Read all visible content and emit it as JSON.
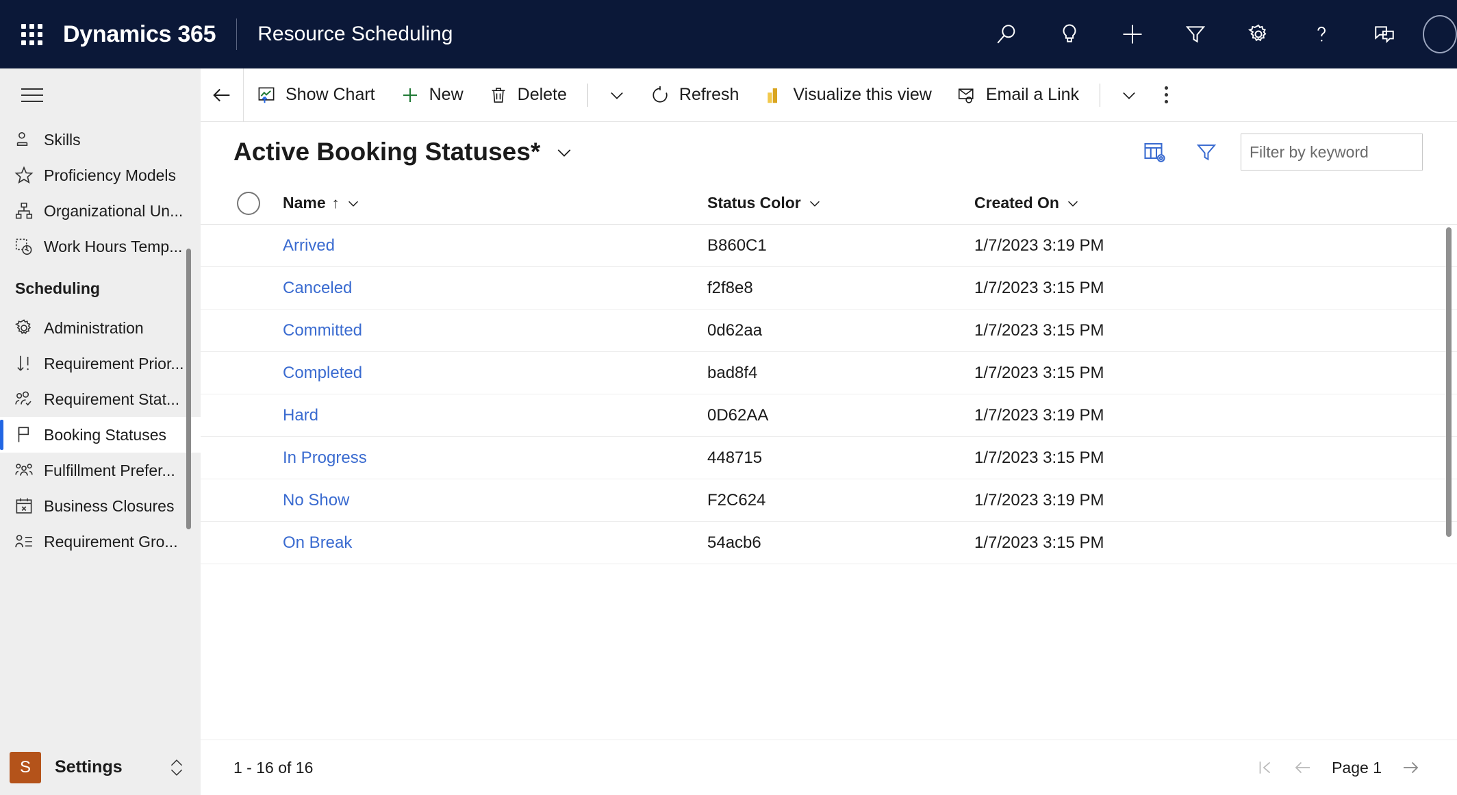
{
  "topbar": {
    "waffle_label": "app-launcher",
    "brand": "Dynamics 365",
    "app_name": "Resource Scheduling",
    "icons": [
      "search-icon",
      "lightbulb-icon",
      "plus-icon",
      "filter-icon",
      "gear-icon",
      "help-icon",
      "feedback-icon",
      "avatar"
    ]
  },
  "sidebar": {
    "items": [
      {
        "label": "Skills",
        "icon": "person-card-icon",
        "selected": false
      },
      {
        "label": "Proficiency Models",
        "icon": "star-icon",
        "selected": false
      },
      {
        "label": "Organizational Un...",
        "icon": "org-chart-icon",
        "selected": false
      },
      {
        "label": "Work Hours Temp...",
        "icon": "clock-template-icon",
        "selected": false
      }
    ],
    "group_title": "Scheduling",
    "group_items": [
      {
        "label": "Administration",
        "icon": "gear-icon",
        "selected": false
      },
      {
        "label": "Requirement Prior...",
        "icon": "sort-priority-icon",
        "selected": false
      },
      {
        "label": "Requirement Stat...",
        "icon": "people-check-icon",
        "selected": false
      },
      {
        "label": "Booking Statuses",
        "icon": "flag-icon",
        "selected": true
      },
      {
        "label": "Fulfillment Prefer...",
        "icon": "people-group-icon",
        "selected": false
      },
      {
        "label": "Business Closures",
        "icon": "calendar-x-icon",
        "selected": false
      },
      {
        "label": "Requirement Gro...",
        "icon": "person-list-icon",
        "selected": false
      }
    ],
    "settings": {
      "tile_letter": "S",
      "label": "Settings",
      "accent": "#b4531a"
    }
  },
  "commandbar": {
    "back": "back-arrow",
    "buttons": [
      {
        "label": "Show Chart",
        "icon": "chart-icon"
      },
      {
        "label": "New",
        "icon": "plus-icon"
      },
      {
        "label": "Delete",
        "icon": "trash-icon"
      }
    ],
    "buttons2": [
      {
        "label": "Refresh",
        "icon": "refresh-icon"
      },
      {
        "label": "Visualize this view",
        "icon": "bar-chart-icon"
      },
      {
        "label": "Email a Link",
        "icon": "email-link-icon"
      }
    ],
    "overflow": "more-commands"
  },
  "view": {
    "title": "Active Booking Statuses*",
    "edit_columns_icon": "edit-columns-icon",
    "filter_icon": "filter-icon",
    "search": {
      "placeholder": "Filter by keyword",
      "value": ""
    }
  },
  "table": {
    "columns": [
      {
        "label": "Name",
        "sort": "↑"
      },
      {
        "label": "Status Color",
        "sort": ""
      },
      {
        "label": "Created On",
        "sort": ""
      }
    ],
    "rows": [
      {
        "name": "Arrived",
        "status_color": "B860C1",
        "created_on": "1/7/2023 3:19 PM"
      },
      {
        "name": "Canceled",
        "status_color": "f2f8e8",
        "created_on": "1/7/2023 3:15 PM"
      },
      {
        "name": "Committed",
        "status_color": "0d62aa",
        "created_on": "1/7/2023 3:15 PM"
      },
      {
        "name": "Completed",
        "status_color": "bad8f4",
        "created_on": "1/7/2023 3:15 PM"
      },
      {
        "name": "Hard",
        "status_color": "0D62AA",
        "created_on": "1/7/2023 3:19 PM"
      },
      {
        "name": "In Progress",
        "status_color": "448715",
        "created_on": "1/7/2023 3:15 PM"
      },
      {
        "name": "No Show",
        "status_color": "F2C624",
        "created_on": "1/7/2023 3:19 PM"
      },
      {
        "name": "On Break",
        "status_color": "54acb6",
        "created_on": "1/7/2023 3:15 PM"
      }
    ]
  },
  "footer": {
    "count": "1 - 16 of 16",
    "page_label": "Page 1",
    "first_icon": "first-page-icon",
    "prev_icon": "previous-page-icon",
    "next_icon": "next-page-icon"
  },
  "colors": {
    "navy": "#0b1838",
    "link": "#3a6bd0",
    "accent_blue": "#2266e3",
    "sidebar_bg": "#eeeeee"
  }
}
